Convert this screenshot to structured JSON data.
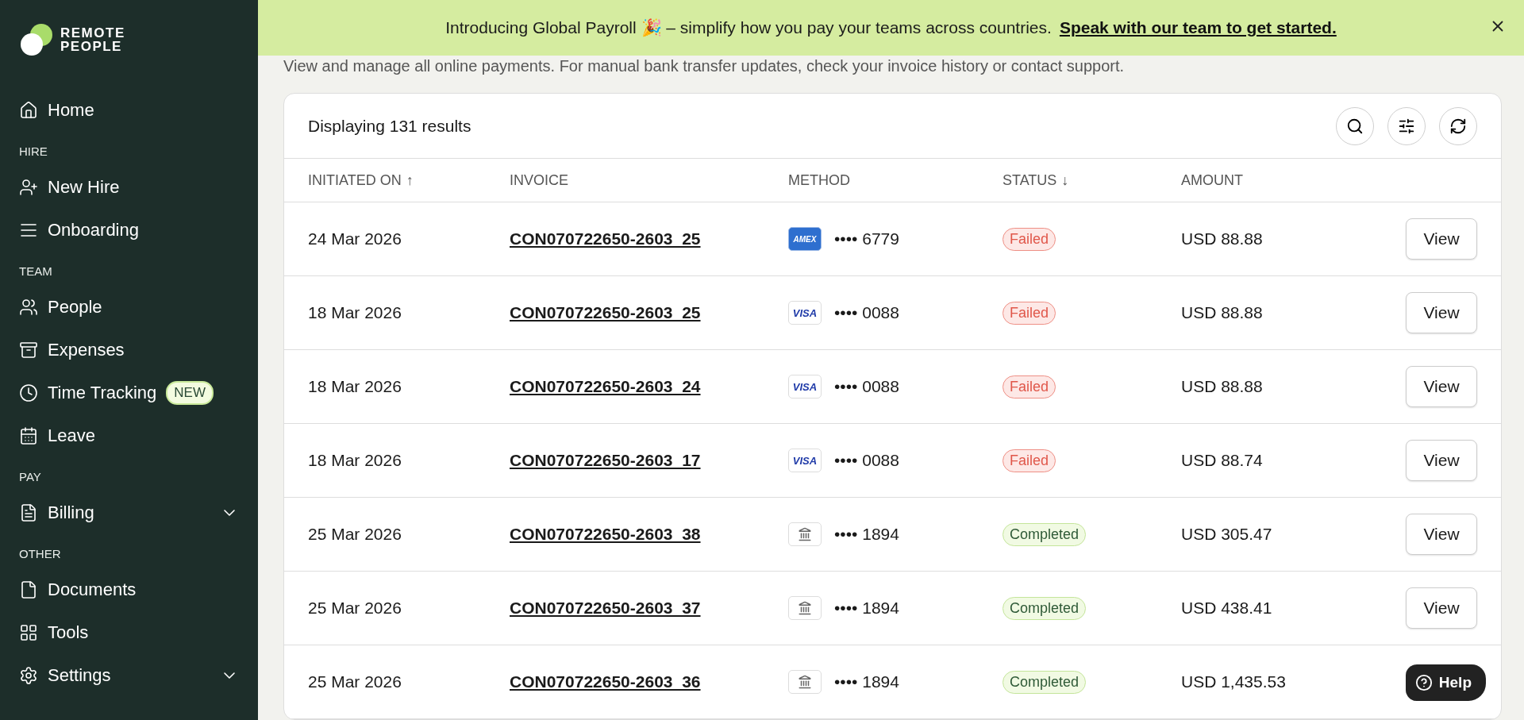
{
  "logo": {
    "lines": [
      "REMOTE",
      "PEOPLE"
    ]
  },
  "sidebar": {
    "sections": [
      {
        "items": [
          {
            "label": "Home"
          }
        ]
      },
      {
        "title": "HIRE",
        "items": [
          {
            "label": "New Hire"
          },
          {
            "label": "Onboarding"
          }
        ]
      },
      {
        "title": "TEAM",
        "items": [
          {
            "label": "People"
          },
          {
            "label": "Expenses"
          },
          {
            "label": "Time Tracking",
            "badge": "NEW"
          },
          {
            "label": "Leave"
          }
        ]
      },
      {
        "title": "PAY",
        "items": [
          {
            "label": "Billing",
            "expanded": false
          }
        ]
      },
      {
        "title": "OTHER",
        "items": [
          {
            "label": "Documents"
          },
          {
            "label": "Tools"
          },
          {
            "label": "Settings",
            "expanded": false
          }
        ]
      }
    ]
  },
  "banner": {
    "text": "Introducing Global Payroll 🎉 – simplify how you pay your teams across countries.",
    "link": "Speak with our team to get started."
  },
  "subtitle": "View and manage all online payments. For manual bank transfer updates, check your invoice history or contact support.",
  "table": {
    "summary": "Displaying 131 results",
    "columns": [
      {
        "label": "INITIATED ON",
        "sort": "↑"
      },
      {
        "label": "INVOICE"
      },
      {
        "label": "METHOD"
      },
      {
        "label": "STATUS",
        "sort": "↓"
      },
      {
        "label": "AMOUNT"
      }
    ],
    "rows": [
      {
        "date": "24 Mar 2026",
        "invoice": "CON070722650-2603_25",
        "method": {
          "kind": "amex",
          "brand": "AMEX",
          "digits": "•••• 6779"
        },
        "status": {
          "kind": "failed",
          "label": "Failed"
        },
        "amount": "USD 88.88",
        "action": "View"
      },
      {
        "date": "18 Mar 2026",
        "invoice": "CON070722650-2603_25",
        "method": {
          "kind": "visa",
          "brand": "VISA",
          "digits": "•••• 0088"
        },
        "status": {
          "kind": "failed",
          "label": "Failed"
        },
        "amount": "USD 88.88",
        "action": "View"
      },
      {
        "date": "18 Mar 2026",
        "invoice": "CON070722650-2603_24",
        "method": {
          "kind": "visa",
          "brand": "VISA",
          "digits": "•••• 0088"
        },
        "status": {
          "kind": "failed",
          "label": "Failed"
        },
        "amount": "USD 88.88",
        "action": "View"
      },
      {
        "date": "18 Mar 2026",
        "invoice": "CON070722650-2603_17",
        "method": {
          "kind": "visa",
          "brand": "VISA",
          "digits": "•••• 0088"
        },
        "status": {
          "kind": "failed",
          "label": "Failed"
        },
        "amount": "USD 88.74",
        "action": "View"
      },
      {
        "date": "25 Mar 2026",
        "invoice": "CON070722650-2603_38",
        "method": {
          "kind": "bank",
          "digits": "•••• 1894"
        },
        "status": {
          "kind": "completed",
          "label": "Completed"
        },
        "amount": "USD 305.47",
        "action": "View"
      },
      {
        "date": "25 Mar 2026",
        "invoice": "CON070722650-2603_37",
        "method": {
          "kind": "bank",
          "digits": "•••• 1894"
        },
        "status": {
          "kind": "completed",
          "label": "Completed"
        },
        "amount": "USD 438.41",
        "action": "View"
      },
      {
        "date": "25 Mar 2026",
        "invoice": "CON070722650-2603_36",
        "method": {
          "kind": "bank",
          "digits": "•••• 1894"
        },
        "status": {
          "kind": "completed",
          "label": "Completed"
        },
        "amount": "USD 1,435.53"
      }
    ]
  },
  "help": {
    "label": "Help"
  }
}
